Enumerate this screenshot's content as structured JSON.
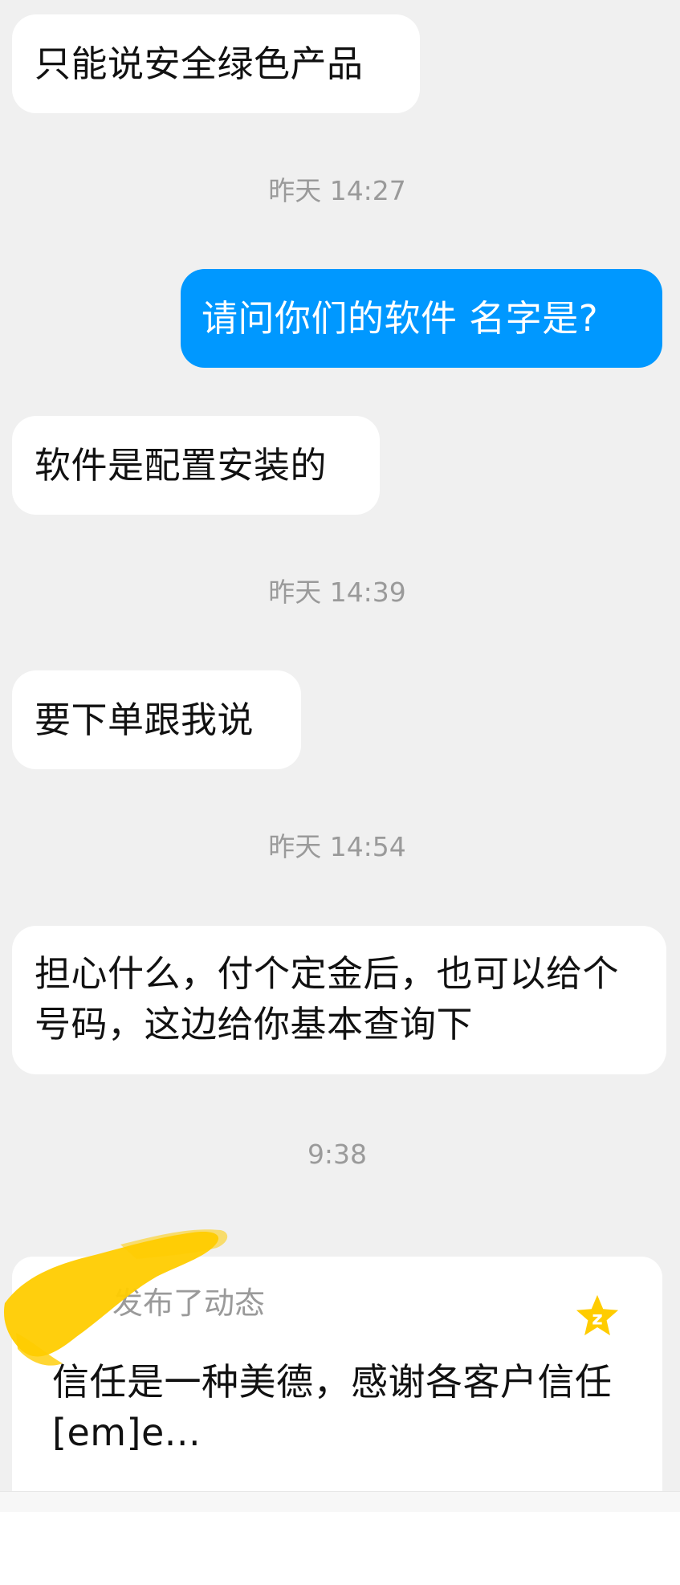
{
  "messages": [
    {
      "side": "in",
      "text": "只能说安全绿色产品"
    },
    {
      "time": "昨天 14:27"
    },
    {
      "side": "out",
      "text": "请问你们的软件 名字是?"
    },
    {
      "side": "in",
      "text": "软件是配置安装的"
    },
    {
      "time": "昨天 14:39"
    },
    {
      "side": "in",
      "text": "要下单跟我说"
    },
    {
      "time": "昨天 14:54"
    },
    {
      "side": "in",
      "text": "担心什么，付个定金后，也可以给个号码，这边给你基本查询下"
    },
    {
      "time": "9:38"
    }
  ],
  "card": {
    "header": "发布了动态",
    "text": "信任是一种美德，感谢各客户信任[em]e...",
    "icon": "qzone-star-icon",
    "icon_color": "#ffcc00"
  },
  "colors": {
    "background": "#f0f0f0",
    "incoming_bubble": "#ffffff",
    "outgoing_bubble": "#0098ff",
    "timestamp": "#9a9a9a",
    "redaction": "#ffcc00"
  }
}
